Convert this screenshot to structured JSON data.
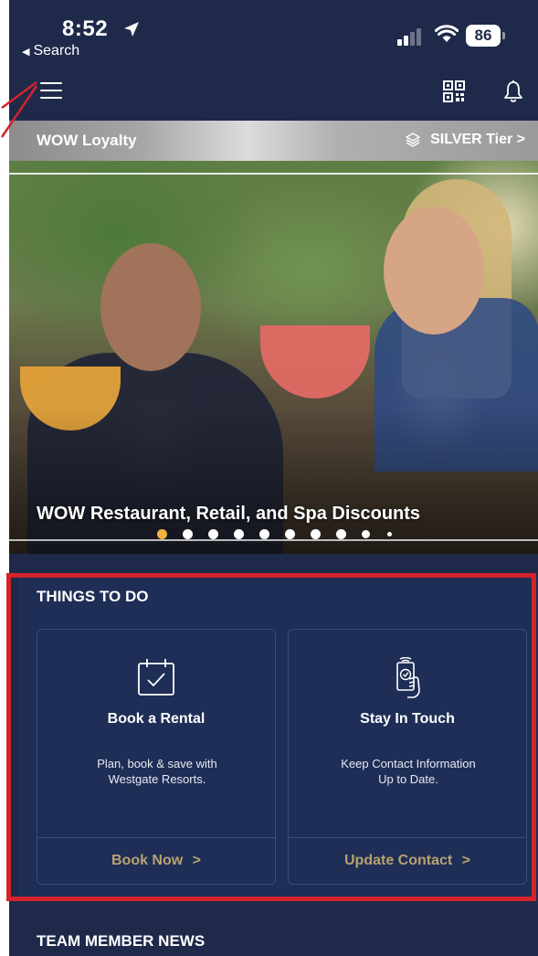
{
  "status_bar": {
    "time": "8:52",
    "back_label": "Search",
    "battery": "86"
  },
  "nav": {
    "menu_icon": "hamburger-menu-icon",
    "qr_icon": "qr-code-icon",
    "bell_icon": "bell-icon"
  },
  "loyalty": {
    "title": "WOW Loyalty",
    "tier": "SILVER Tier >"
  },
  "carousel": {
    "caption": "WOW Restaurant, Retail, and Spa Discounts",
    "slide_count": 10,
    "active_index": 0,
    "active_color": "#f0b43c"
  },
  "things_to_do": {
    "title": "THINGS TO DO",
    "highlight_color": "#d3242b",
    "cards": [
      {
        "icon": "calendar-check-icon",
        "title": "Book a Rental",
        "desc_line1": "Plan, book & save with",
        "desc_line2": "Westgate Resorts.",
        "link": "Book Now",
        "link_chevron": ">"
      },
      {
        "icon": "phone-hand-icon",
        "title": "Stay In Touch",
        "desc_line1": "Keep Contact Information",
        "desc_line2": "Up to Date.",
        "link": "Update Contact",
        "link_chevron": ">"
      }
    ]
  },
  "news": {
    "title": "TEAM MEMBER NEWS"
  },
  "colors": {
    "background": "#1f2a4a",
    "section_bg": "#1f2e56",
    "link_gold": "#b9a271"
  }
}
